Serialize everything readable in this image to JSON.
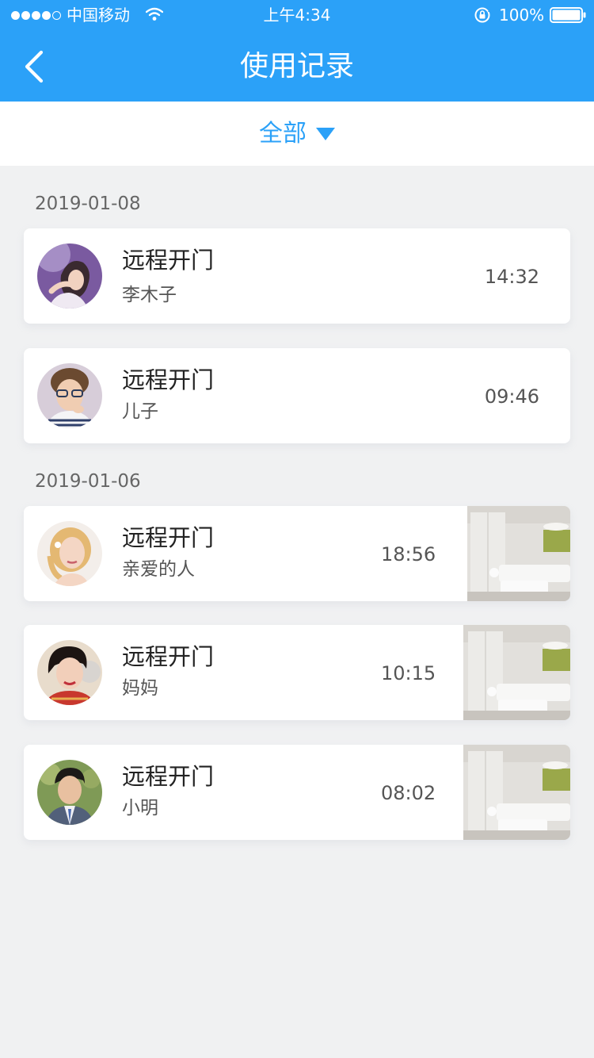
{
  "status_bar": {
    "carrier": "中国移动",
    "time": "上午4:34",
    "battery": "100%"
  },
  "header": {
    "title": "使用记录",
    "back_icon": "chevron-left-icon"
  },
  "filter": {
    "label": "全部",
    "arrow_icon": "triangle-down-icon"
  },
  "colors": {
    "brand": "#2ba1f8",
    "background": "#f0f1f2",
    "card": "#ffffff"
  },
  "groups": [
    {
      "date": "2019-01-08",
      "records": [
        {
          "action": "远程开门",
          "person": "李木子",
          "time": "14:32",
          "has_snapshot": false
        },
        {
          "action": "远程开门",
          "person": "儿子",
          "time": "09:46",
          "has_snapshot": false
        }
      ]
    },
    {
      "date": "2019-01-06",
      "records": [
        {
          "action": "远程开门",
          "person": "亲爱的人",
          "time": "18:56",
          "has_snapshot": true
        },
        {
          "action": "远程开门",
          "person": "妈妈",
          "time": "10:15",
          "has_snapshot": true
        },
        {
          "action": "远程开门",
          "person": "小明",
          "time": "08:02",
          "has_snapshot": true
        }
      ]
    }
  ]
}
